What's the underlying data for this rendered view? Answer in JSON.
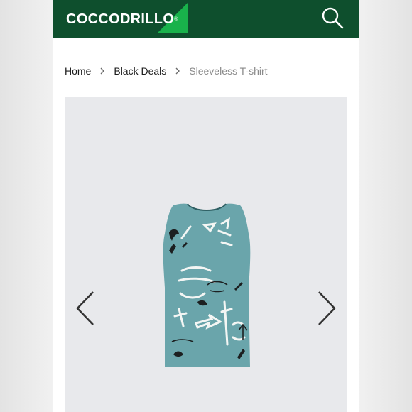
{
  "header": {
    "brand": "COCCODRILLO",
    "reg_mark": "®",
    "search_icon": "search-icon",
    "background": "#0e4f2d",
    "accent": "#19b24b"
  },
  "breadcrumb": {
    "items": [
      {
        "label": "Home"
      },
      {
        "label": "Black Deals"
      },
      {
        "label": "Sleeveless T-shirt"
      }
    ],
    "separator_icon": "chevron-right-icon"
  },
  "gallery": {
    "prev_icon": "chevron-left-icon",
    "next_icon": "chevron-right-icon",
    "product_image": "sleeveless-tshirt-image",
    "product_color": "#6aa5ab"
  }
}
